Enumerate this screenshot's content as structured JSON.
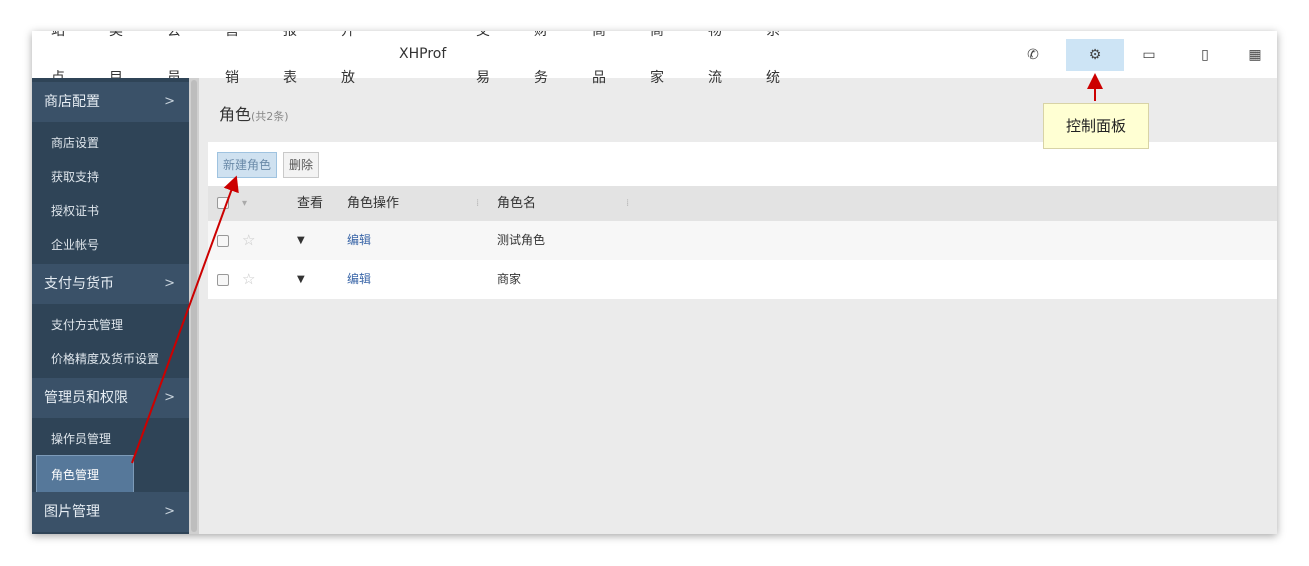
{
  "topnav": {
    "items": [
      "站点",
      "类目",
      "会员",
      "营销",
      "报表",
      "开放",
      "XHProf",
      "交易",
      "财务",
      "商品",
      "商家",
      "物流",
      "系统"
    ],
    "tools": [
      "phone-icon",
      "gears-icon",
      "monitor-icon",
      "mobile-icon",
      "building-icon"
    ],
    "tool_glyphs": [
      "✆",
      "⚙",
      "▭",
      "▯",
      "▦"
    ]
  },
  "sidebar": {
    "groups": [
      {
        "label": "商店配置",
        "chevron": ">",
        "items": [
          "商店设置",
          "获取支持",
          "授权证书",
          "企业帐号"
        ]
      },
      {
        "label": "支付与货币",
        "chevron": ">",
        "items": [
          "支付方式管理",
          "价格精度及货币设置"
        ]
      },
      {
        "label": "管理员和权限",
        "chevron": ">",
        "items": [
          "操作员管理",
          "角色管理"
        ]
      },
      {
        "label": "图片管理",
        "chevron": ">",
        "items": []
      }
    ],
    "active_item": "角色管理"
  },
  "main": {
    "title": "角色",
    "count": "(共2条)",
    "buttons": {
      "new": "新建角色",
      "delete": "删除"
    },
    "columns": {
      "view": "查看",
      "ops": "角色操作",
      "name": "角色名"
    },
    "rows": [
      {
        "action": "编辑",
        "name": "测试角色"
      },
      {
        "action": "编辑",
        "name": "商家"
      }
    ]
  },
  "annotation": {
    "tooltip": "控制面板"
  },
  "colors": {
    "accent": "#cde4f5",
    "sidebar": "#2f4457",
    "arrow": "#cc0000"
  }
}
